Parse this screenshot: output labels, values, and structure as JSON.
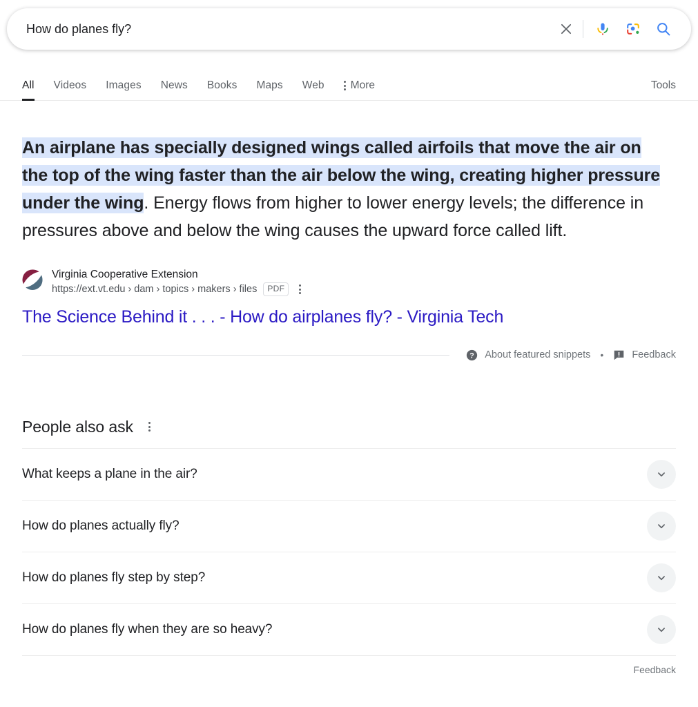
{
  "search": {
    "query": "How do planes fly?",
    "placeholder": "Search",
    "clear_label": "Clear",
    "voice_label": "Search by voice",
    "lens_label": "Search by image",
    "submit_label": "Google Search"
  },
  "nav": {
    "tabs": [
      {
        "label": "All",
        "active": true
      },
      {
        "label": "Videos",
        "active": false
      },
      {
        "label": "Images",
        "active": false
      },
      {
        "label": "News",
        "active": false
      },
      {
        "label": "Books",
        "active": false
      },
      {
        "label": "Maps",
        "active": false
      },
      {
        "label": "Web",
        "active": false
      }
    ],
    "more_label": "More",
    "tools_label": "Tools"
  },
  "featured_snippet": {
    "bold_text": "An airplane has specially designed wings called airfoils that move the air on the top of the wing faster than the air below the wing, creating higher pressure under the wing",
    "rest_text": ". Energy flows from higher to lower energy levels; the difference in pressures above and below the wing causes the upward force called lift.",
    "source_name": "Virginia Cooperative Extension",
    "source_url": "https://ext.vt.edu › dam › topics › makers › files",
    "file_badge": "PDF",
    "result_title": "The Science Behind it . . . - How do airplanes fly? - Virginia Tech",
    "about_label": "About featured snippets",
    "separator": "•",
    "feedback_label": "Feedback"
  },
  "people_also_ask": {
    "title": "People also ask",
    "questions": [
      "What keeps a plane in the air?",
      "How do planes actually fly?",
      "How do planes fly step by step?",
      "How do planes fly when they are so heavy?"
    ],
    "feedback_label": "Feedback"
  },
  "colors": {
    "highlight": "#d9e5fb",
    "link": "#2b1ac4",
    "text": "#202124",
    "muted": "#70757a",
    "google_blue": "#4285f4",
    "google_red": "#ea4335",
    "google_yellow": "#fbbc04",
    "google_green": "#34a853"
  },
  "icons": {
    "clear": "close-icon",
    "voice": "microphone-icon",
    "lens": "google-lens-icon",
    "search": "search-icon",
    "more": "dots-vertical-icon",
    "expand": "chevron-down-icon",
    "help": "help-circle-icon",
    "feedback": "feedback-flag-icon"
  }
}
